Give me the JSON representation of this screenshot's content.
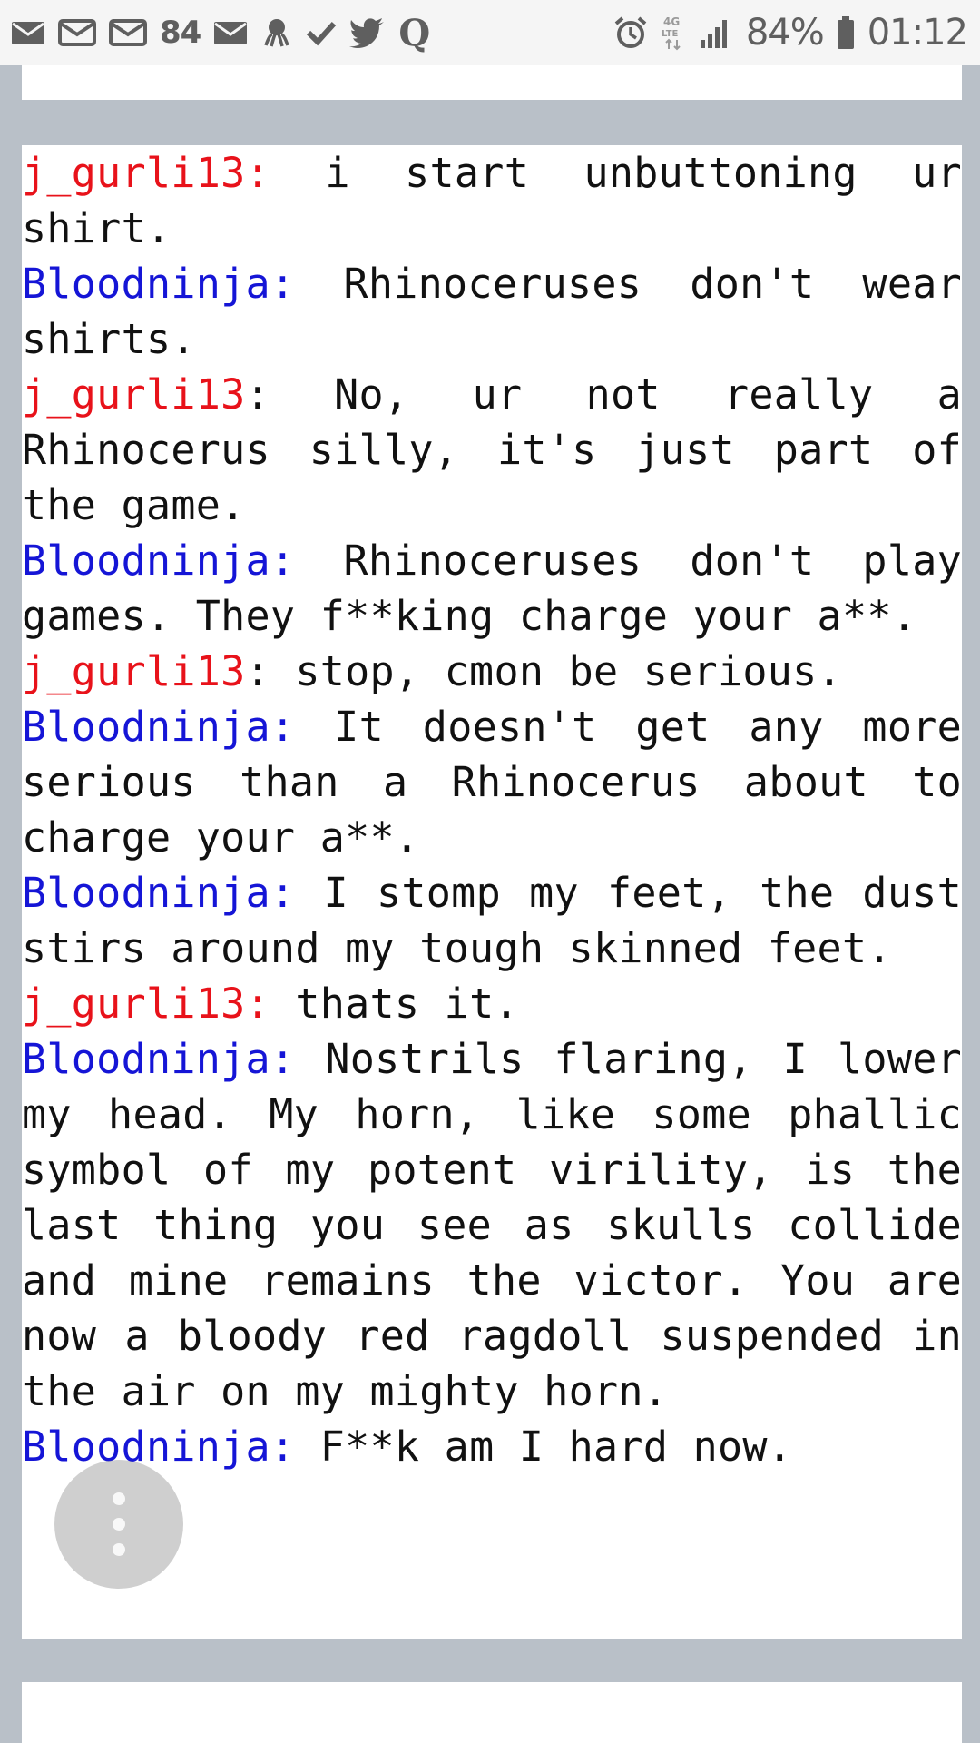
{
  "status_bar": {
    "left_icons": [
      "mail-icon",
      "mail-icon",
      "mail-icon"
    ],
    "notification_count": "84",
    "more_icons": [
      "mail-icon",
      "octopus-icon",
      "check-icon",
      "twitter-icon",
      "q-icon"
    ],
    "right_icons": [
      "alarm-icon",
      "4g-lte-icon",
      "signal-icon",
      "battery-icon"
    ],
    "battery": "84%",
    "time": "01:12"
  },
  "colors": {
    "j_gurli13": "#e8121a",
    "Bloodninja": "#1515d6",
    "background": "#b9c0c8"
  },
  "chat": [
    {
      "speaker": "j_gurli13:",
      "text": " i start unbuttoning ur shirt."
    },
    {
      "speaker": "Bloodninja:",
      "text": " Rhinoceruses don't wear shirts."
    },
    {
      "speaker": "j_gurli13",
      "text": ": No, ur not really a Rhinocerus silly, it's just part of the game."
    },
    {
      "speaker": "Bloodninja:",
      "text": " Rhinoceruses don't play games. They f**king charge your a**."
    },
    {
      "speaker": "j_gurli13",
      "text": ": stop, cmon be serious."
    },
    {
      "speaker": "Bloodninja:",
      "text": " It doesn't get any more serious than a Rhinocerus about to charge your a**."
    },
    {
      "speaker": "Bloodninja:",
      "text": " I stomp my feet, the dust stirs around my tough skinned feet."
    },
    {
      "speaker": "j_gurli13:",
      "text": " thats it."
    },
    {
      "speaker": "Bloodninja:",
      "text": " Nostrils flaring, I lower my head. My horn, like some phallic symbol of my potent virility, is the last thing you see as skulls collide and mine remains the victor. You are now a bloody red ragdoll suspended in the air on my mighty horn."
    },
    {
      "speaker": "Bloodninja:",
      "text": " F**k am I hard now."
    }
  ]
}
